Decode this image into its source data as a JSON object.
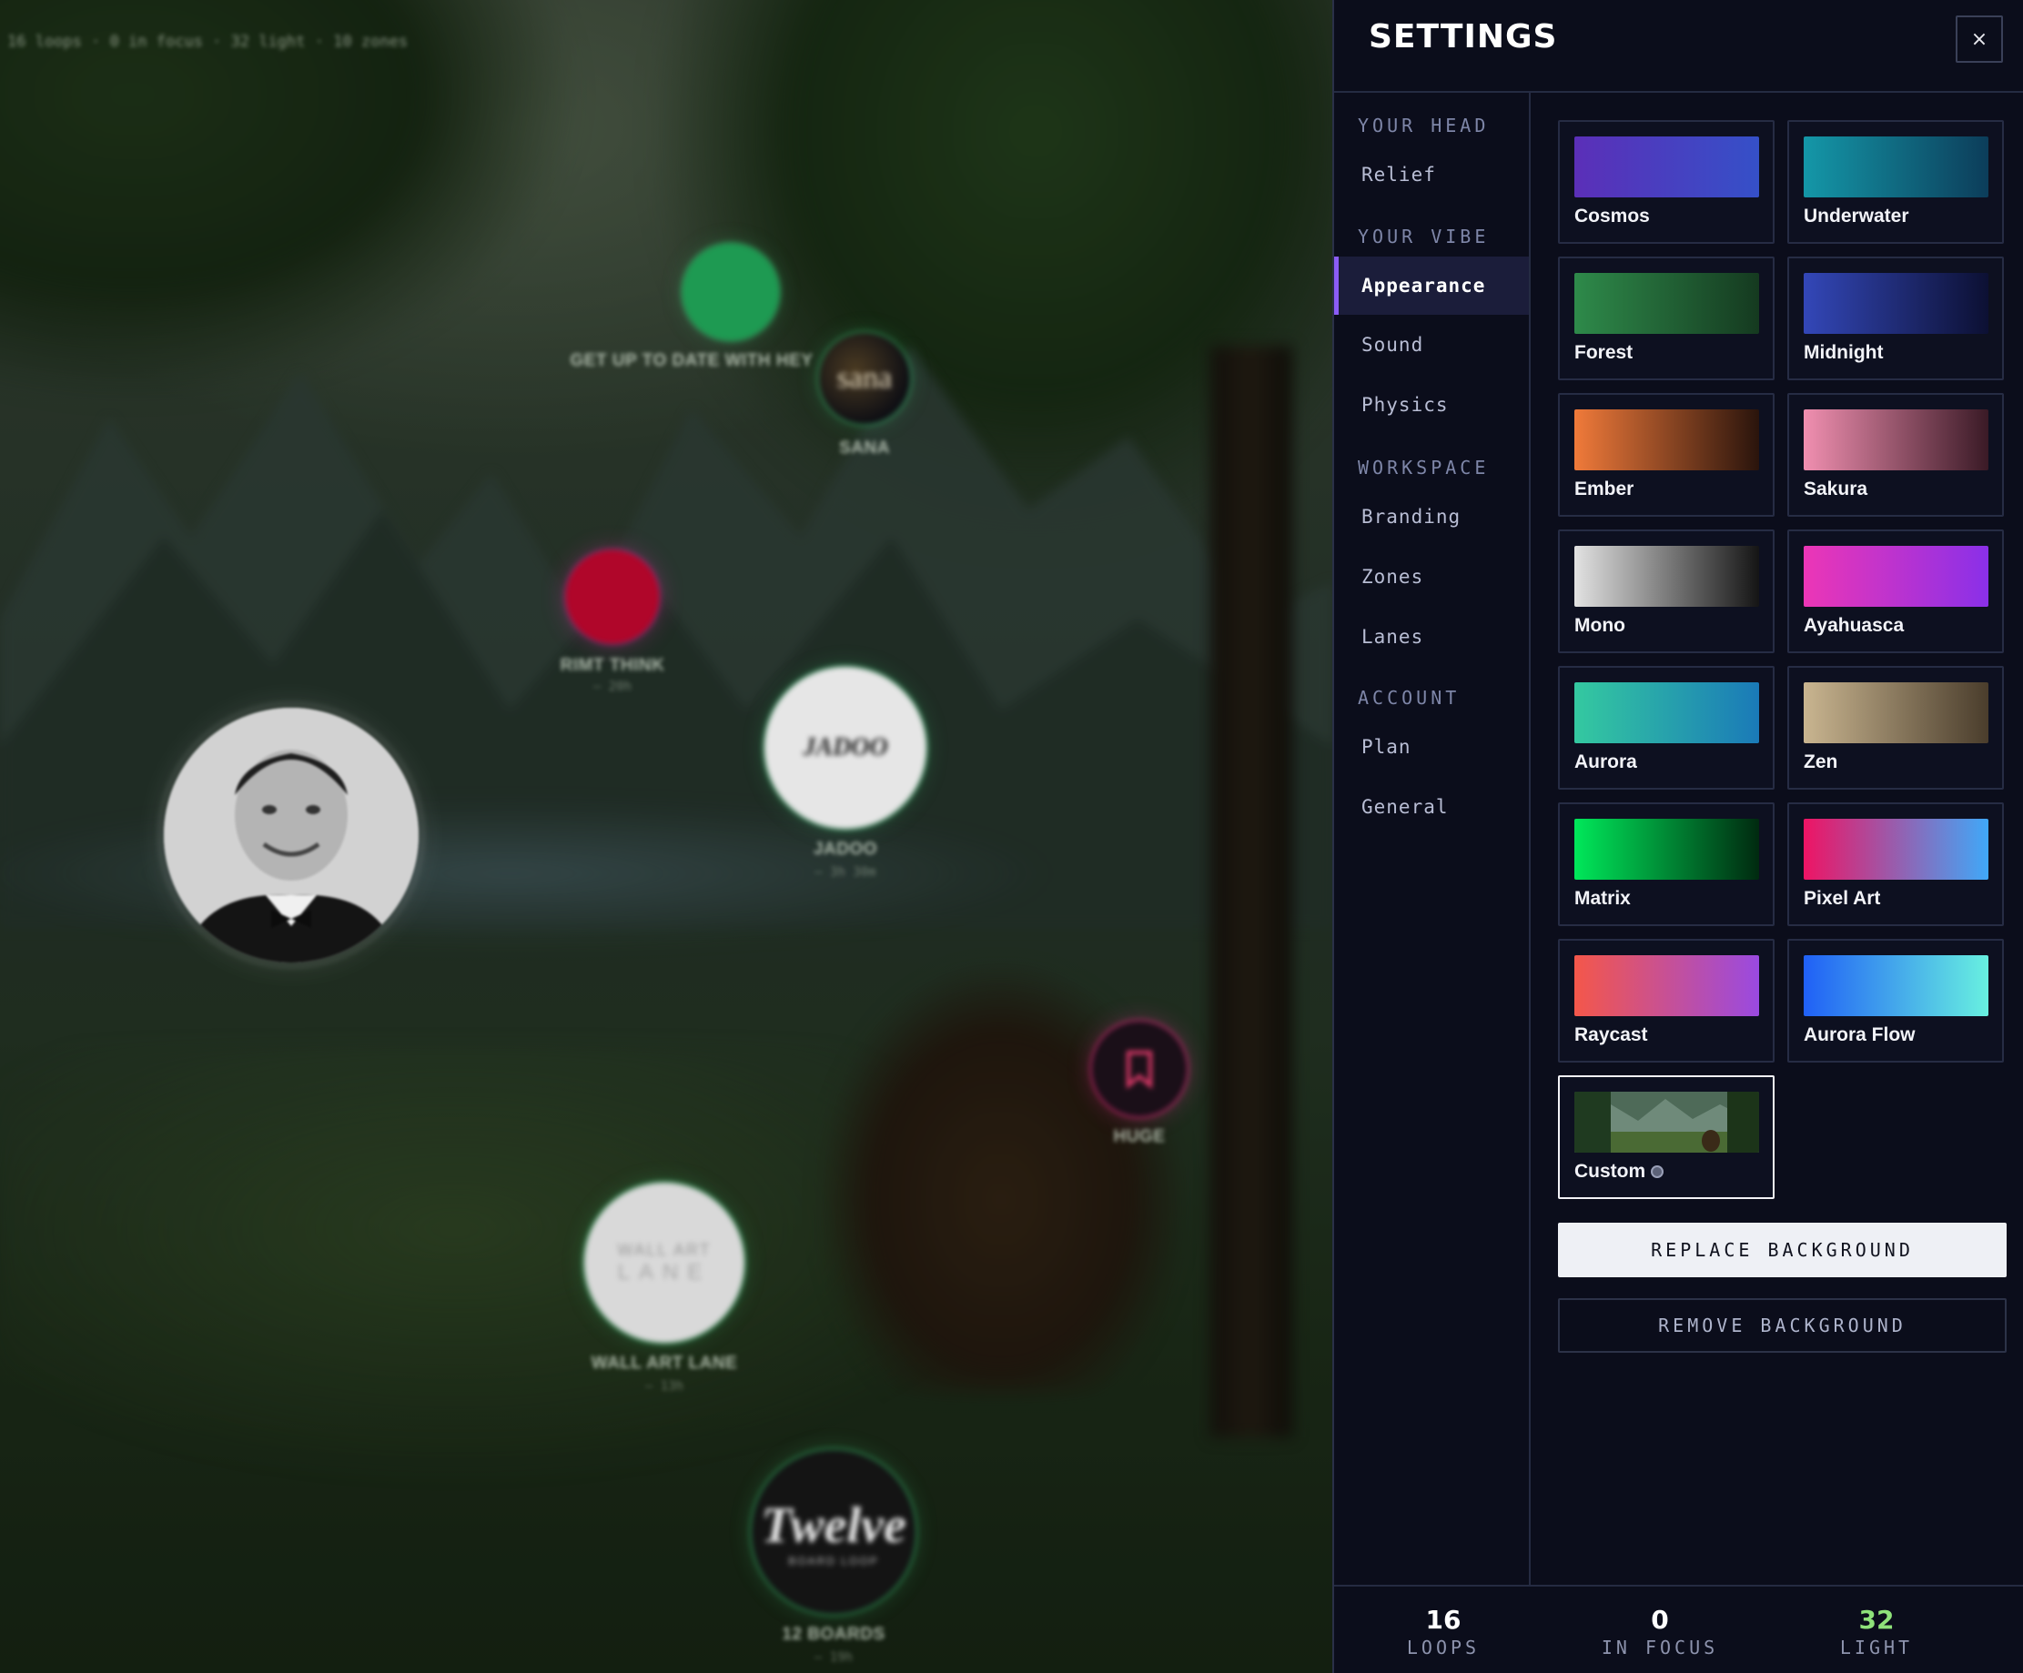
{
  "canvas": {
    "top_stats": "16 loops · 0 in focus · 32 light · 10 zones",
    "nodes": [
      {
        "label": "GET UP TO DATE WITH HEY",
        "sub": ""
      },
      {
        "label": "SANA",
        "logo": "sana",
        "sub": ""
      },
      {
        "label": "RIMT THINK",
        "sub": "— 20h"
      },
      {
        "label": "JADOO",
        "logo": "JADOO",
        "sub": "— 3h 30m"
      },
      {
        "label": "HUGE",
        "sub": ""
      },
      {
        "label": "WALL ART LANE",
        "logo_line1": "WALL ART",
        "logo_line2": "LANE",
        "sub": "— 13h"
      },
      {
        "label": "12 BOARDS",
        "logo": "Twelve",
        "logo_sub": "BOARD LOOP",
        "sub": "— 19h"
      }
    ]
  },
  "settings": {
    "title": "SETTINGS",
    "close_label": "×",
    "nav": {
      "sections": [
        {
          "label": "YOUR HEAD",
          "items": [
            "Relief"
          ]
        },
        {
          "label": "YOUR VIBE",
          "items": [
            "Appearance",
            "Sound",
            "Physics"
          ]
        },
        {
          "label": "WORKSPACE",
          "items": [
            "Branding",
            "Zones",
            "Lanes"
          ]
        },
        {
          "label": "ACCOUNT",
          "items": [
            "Plan",
            "General"
          ]
        }
      ],
      "active": "Appearance"
    },
    "themes": [
      {
        "name": "Cosmos",
        "gradient": [
          "#5b2fb8",
          "#3550c8"
        ]
      },
      {
        "name": "Underwater",
        "gradient": [
          "#1497a8",
          "#0c3d5a"
        ]
      },
      {
        "name": "Forest",
        "gradient": [
          "#2e8a4a",
          "#153a20"
        ]
      },
      {
        "name": "Midnight",
        "gradient": [
          "#3347b8",
          "#0c1033"
        ]
      },
      {
        "name": "Ember",
        "gradient": [
          "#f07a3a",
          "#2a140c"
        ]
      },
      {
        "name": "Sakura",
        "gradient": [
          "#f08fb0",
          "#3a1a26"
        ]
      },
      {
        "name": "Mono",
        "gradient": [
          "#e2e2e2",
          "#151515"
        ]
      },
      {
        "name": "Ayahuasca",
        "gradient": [
          "#ec36b6",
          "#8a30e8"
        ]
      },
      {
        "name": "Aurora",
        "gradient": [
          "#34c9a0",
          "#1a7ab8"
        ]
      },
      {
        "name": "Zen",
        "gradient": [
          "#c9b590",
          "#4a3d2c"
        ]
      },
      {
        "name": "Matrix",
        "gradient": [
          "#00e85a",
          "#002a10"
        ]
      },
      {
        "name": "Pixel Art",
        "gradient": [
          "#ee1464",
          "#40a8f8"
        ]
      },
      {
        "name": "Raycast",
        "gradient": [
          "#f4574a",
          "#9a4ae0"
        ]
      },
      {
        "name": "Aurora Flow",
        "gradient": [
          "#2060f6",
          "#68f0e0"
        ]
      },
      {
        "name": "Custom",
        "custom": true
      }
    ],
    "selected_theme": "Custom",
    "replace_label": "REPLACE BACKGROUND",
    "remove_label": "REMOVE BACKGROUND"
  },
  "footer": {
    "stats": [
      {
        "value": "16",
        "label": "LOOPS",
        "color": "#ffffff"
      },
      {
        "value": "0",
        "label": "IN FOCUS",
        "color": "#ffffff"
      },
      {
        "value": "32",
        "label": "LIGHT",
        "color": "#8fe27a"
      }
    ]
  }
}
